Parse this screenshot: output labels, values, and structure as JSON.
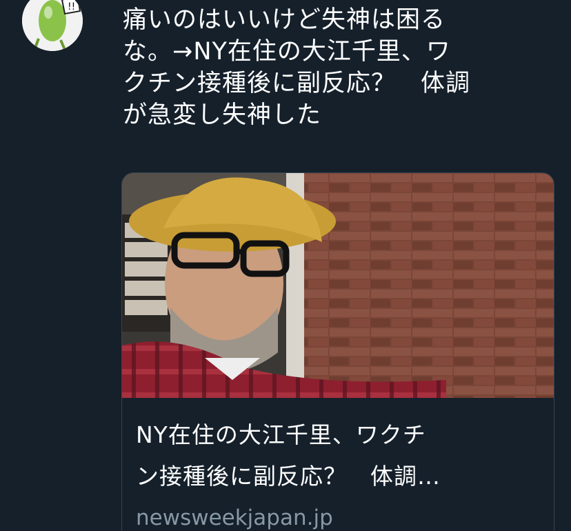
{
  "tweet": {
    "text_lines": [
      "痛いのはいいけど失神は困る",
      "な。→NY在住の大江千里、ワ",
      "クチン接種後に副反応？　体調",
      "が急変し失神した"
    ]
  },
  "card": {
    "title_lines": [
      "NY在住の大江千里、ワクチ",
      "ン接種後に副反応？　体調…"
    ],
    "domain": "newsweekjapan.jp"
  },
  "icons": {
    "avatar": "avatar",
    "card_image": "article-photo"
  },
  "colors": {
    "background": "#15202b",
    "text": "#ffffff",
    "secondary_text": "#8899a6",
    "card_border": "#38444d"
  }
}
